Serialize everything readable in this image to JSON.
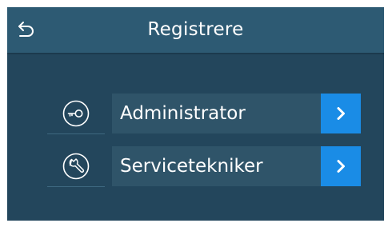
{
  "header": {
    "title": "Registrere",
    "back_icon": "back-arrow-icon"
  },
  "menu": {
    "items": [
      {
        "label": "Administrator",
        "icon": "key-icon",
        "action_icon": "chevron-right-icon"
      },
      {
        "label": "Servicetekniker",
        "icon": "wrench-icon",
        "action_icon": "chevron-right-icon"
      }
    ]
  },
  "colors": {
    "panel_background": "#23465c",
    "header_background": "#2d5a73",
    "item_background": "#2f5469",
    "accent": "#1a8ce6",
    "text": "#ffffff"
  }
}
